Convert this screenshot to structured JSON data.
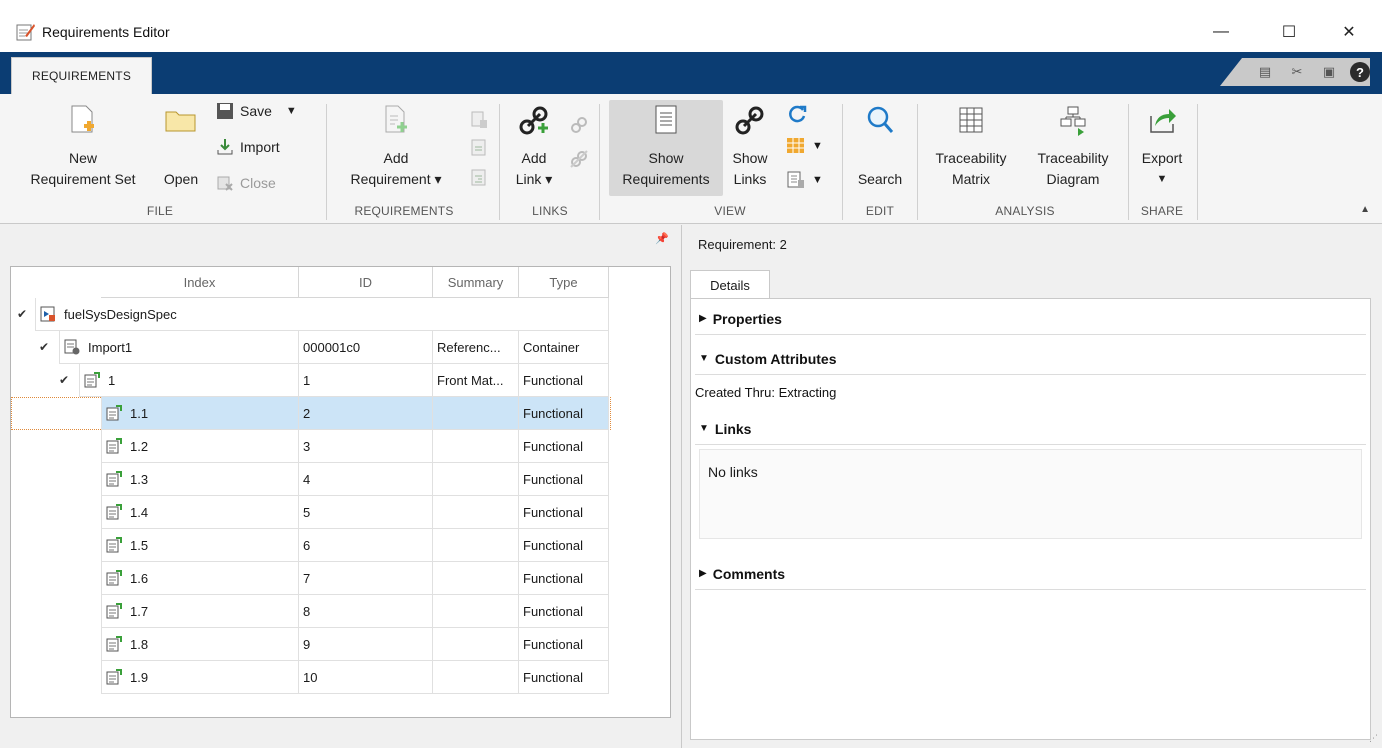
{
  "window": {
    "title": "Requirements Editor",
    "minimize": "—",
    "maximize": "☐",
    "close": "✕"
  },
  "tabstrip": {
    "active_tab": "REQUIREMENTS"
  },
  "ribbon": {
    "file": {
      "label": "FILE",
      "new": "New\nRequirement Set",
      "new_l1": "New",
      "new_l2": "Requirement Set",
      "open": "Open",
      "save": "Save",
      "import": "Import",
      "close": "Close"
    },
    "requirements": {
      "label": "REQUIREMENTS",
      "add_l1": "Add",
      "add_l2": "Requirement ▾"
    },
    "links": {
      "label": "LINKS",
      "add_l1": "Add",
      "add_l2": "Link ▾"
    },
    "view": {
      "label": "VIEW",
      "show_req_l1": "Show",
      "show_req_l2": "Requirements",
      "show_links_l1": "Show",
      "show_links_l2": "Links"
    },
    "edit": {
      "label": "EDIT",
      "search": "Search"
    },
    "analysis": {
      "label": "ANALYSIS",
      "tm_l1": "Traceability",
      "tm_l2": "Matrix",
      "td_l1": "Traceability",
      "td_l2": "Diagram"
    },
    "share": {
      "label": "SHARE",
      "export": "Export"
    }
  },
  "tree": {
    "headers": {
      "index": "Index",
      "id": "ID",
      "summary": "Summary",
      "type": "Type"
    },
    "root": "fuelSysDesignSpec",
    "rows": [
      {
        "index": "Import1",
        "id": "000001c0",
        "summary": "Referenc...",
        "type": "Container"
      },
      {
        "index": "1",
        "id": "1",
        "summary": "Front Mat...",
        "type": "Functional"
      },
      {
        "index": "1.1",
        "id": "2",
        "summary": "",
        "type": "Functional"
      },
      {
        "index": "1.2",
        "id": "3",
        "summary": "",
        "type": "Functional"
      },
      {
        "index": "1.3",
        "id": "4",
        "summary": "",
        "type": "Functional"
      },
      {
        "index": "1.4",
        "id": "5",
        "summary": "",
        "type": "Functional"
      },
      {
        "index": "1.5",
        "id": "6",
        "summary": "",
        "type": "Functional"
      },
      {
        "index": "1.6",
        "id": "7",
        "summary": "",
        "type": "Functional"
      },
      {
        "index": "1.7",
        "id": "8",
        "summary": "",
        "type": "Functional"
      },
      {
        "index": "1.8",
        "id": "9",
        "summary": "",
        "type": "Functional"
      },
      {
        "index": "1.9",
        "id": "10",
        "summary": "",
        "type": "Functional"
      }
    ]
  },
  "details": {
    "header": "Requirement: 2",
    "tab": "Details",
    "properties": "Properties",
    "custom_attributes": "Custom Attributes",
    "created_thru": "Created Thru:  Extracting",
    "links": "Links",
    "no_links": "No links",
    "comments": "Comments"
  }
}
